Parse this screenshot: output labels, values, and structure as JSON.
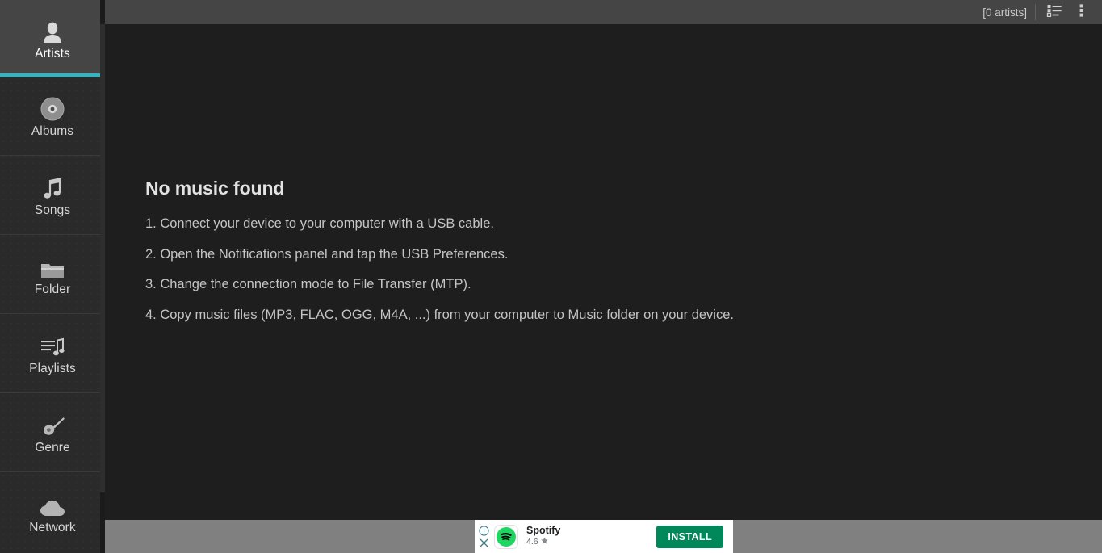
{
  "sidebar": {
    "items": [
      {
        "id": "artists",
        "label": "Artists",
        "icon": "person-icon",
        "active": true
      },
      {
        "id": "albums",
        "label": "Albums",
        "icon": "disc-icon",
        "active": false
      },
      {
        "id": "songs",
        "label": "Songs",
        "icon": "music-note-icon",
        "active": false
      },
      {
        "id": "folder",
        "label": "Folder",
        "icon": "folder-icon",
        "active": false
      },
      {
        "id": "playlists",
        "label": "Playlists",
        "icon": "playlist-icon",
        "active": false
      },
      {
        "id": "genre",
        "label": "Genre",
        "icon": "guitar-icon",
        "active": false
      },
      {
        "id": "network",
        "label": "Network",
        "icon": "cloud-icon",
        "active": false
      }
    ],
    "active_accent_color": "#2bb8c4",
    "active_background_color": "#454545"
  },
  "topbar": {
    "count_label": "[0 artists]",
    "view_mode_icon": "list-view-icon",
    "overflow_icon": "more-vertical-icon",
    "background_color": "#454545"
  },
  "content": {
    "title": "No music found",
    "steps": [
      "1. Connect your device to your computer with a USB cable.",
      "2. Open the Notifications panel and tap the USB Preferences.",
      "3. Change the connection mode to File Transfer (MTP).",
      "4. Copy music files (MP3, FLAC, OGG, M4A, ...) from your computer to Music folder on your device."
    ],
    "background_color": "#1e1e1e"
  },
  "ad": {
    "info_icon": "info-circle-icon",
    "close_icon": "close-icon",
    "app_logo_icon": "spotify-logo-icon",
    "app_name": "Spotify",
    "rating": "4.6",
    "rating_star_icon": "star-icon",
    "install_label": "INSTALL",
    "install_color": "#00875a",
    "brand_color": "#1ed760",
    "strip_color": "#808080"
  }
}
